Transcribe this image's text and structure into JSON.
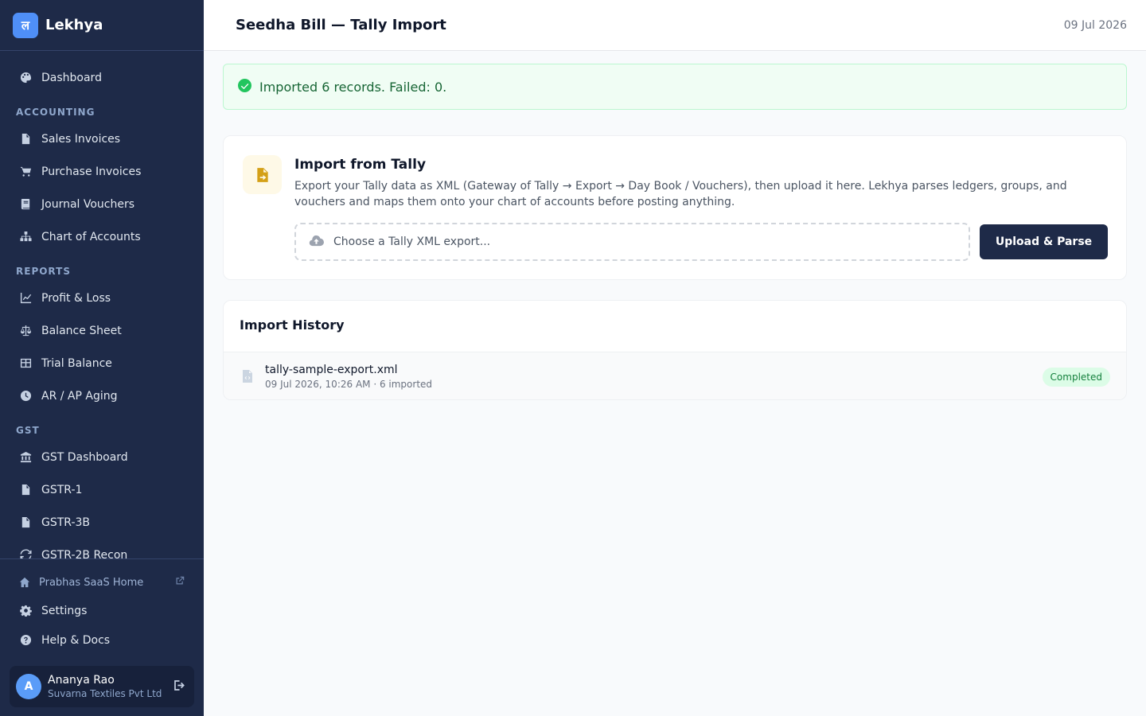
{
  "brand": {
    "logo_letter": "ल",
    "name": "Lekhya",
    "accent_color": "#4f8ff7",
    "sidebar_bg": "#1e2a48"
  },
  "sidebar": {
    "dashboard": {
      "label": "Dashboard",
      "icon": "palette-icon"
    },
    "sections": [
      {
        "title": "ACCOUNTING",
        "items": [
          {
            "label": "Sales Invoices",
            "icon": "document-icon"
          },
          {
            "label": "Purchase Invoices",
            "icon": "cart-icon"
          },
          {
            "label": "Journal Vouchers",
            "icon": "book-icon"
          },
          {
            "label": "Chart of Accounts",
            "icon": "sitemap-icon"
          }
        ]
      },
      {
        "title": "REPORTS",
        "items": [
          {
            "label": "Profit & Loss",
            "icon": "line-chart-icon"
          },
          {
            "label": "Balance Sheet",
            "icon": "scale-icon"
          },
          {
            "label": "Trial Balance",
            "icon": "table-icon"
          },
          {
            "label": "AR / AP Aging",
            "icon": "clock-icon"
          }
        ]
      },
      {
        "title": "GST",
        "items": [
          {
            "label": "GST Dashboard",
            "icon": "bank-icon"
          },
          {
            "label": "GSTR-1",
            "icon": "document-icon"
          },
          {
            "label": "GSTR-3B",
            "icon": "document-icon"
          },
          {
            "label": "GSTR-2B Recon",
            "icon": "sync-icon"
          }
        ]
      }
    ],
    "home_link": {
      "label": "Prabhas SaaS Home",
      "icon": "home-icon",
      "external_icon": "external-link-icon"
    },
    "settings": {
      "label": "Settings",
      "icon": "gear-icon"
    },
    "help": {
      "label": "Help & Docs",
      "icon": "question-circle-icon"
    },
    "user": {
      "initial": "A",
      "name": "Ananya Rao",
      "org": "Suvarna Textiles Pvt Ltd"
    }
  },
  "header": {
    "title": "Seedha Bill — Tally Import",
    "date": "09 Jul 2026"
  },
  "alert": {
    "text": "Imported 6 records. Failed: 0.",
    "color": "#16a34a"
  },
  "import": {
    "title": "Import from Tally",
    "description": "Export your Tally data as XML (Gateway of Tally → Export → Day Book / Vouchers), then upload it here. Lekhya parses ledgers, groups, and vouchers and maps them onto your chart of accounts before posting anything.",
    "file_placeholder": "Choose a Tally XML export...",
    "button_label": "Upload & Parse"
  },
  "history": {
    "title": "Import History",
    "rows": [
      {
        "file": "tally-sample-export.xml",
        "meta": "09 Jul 2026, 10:26 AM · 6 imported",
        "status": "Completed"
      }
    ]
  }
}
